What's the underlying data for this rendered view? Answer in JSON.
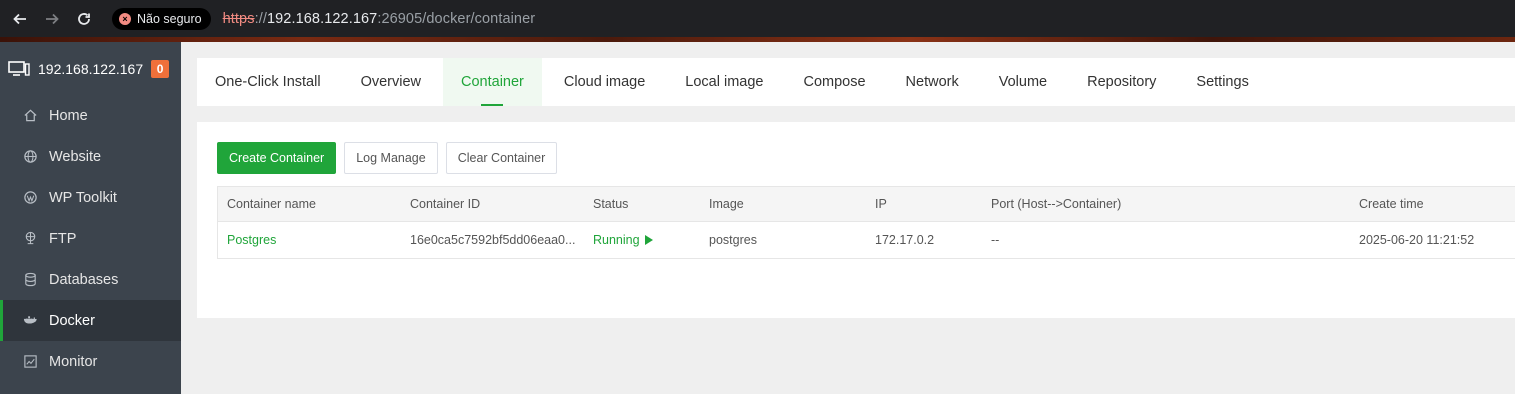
{
  "browser": {
    "security_label": "Não seguro",
    "url_scheme": "https",
    "url_sep": "://",
    "url_host": "192.168.122.167",
    "url_rest": ":26905/docker/container"
  },
  "sidebar": {
    "server_name": "192.168.122.167",
    "badge_count": "0",
    "items": [
      {
        "label": "Home",
        "icon": "home-icon"
      },
      {
        "label": "Website",
        "icon": "globe-icon"
      },
      {
        "label": "WP Toolkit",
        "icon": "wordpress-icon"
      },
      {
        "label": "FTP",
        "icon": "ftp-icon"
      },
      {
        "label": "Databases",
        "icon": "database-icon"
      },
      {
        "label": "Docker",
        "icon": "docker-icon",
        "active": true
      },
      {
        "label": "Monitor",
        "icon": "monitor-icon"
      }
    ]
  },
  "tabs": [
    {
      "label": "One-Click Install"
    },
    {
      "label": "Overview"
    },
    {
      "label": "Container",
      "active": true
    },
    {
      "label": "Cloud image"
    },
    {
      "label": "Local image"
    },
    {
      "label": "Compose"
    },
    {
      "label": "Network"
    },
    {
      "label": "Volume"
    },
    {
      "label": "Repository"
    },
    {
      "label": "Settings"
    }
  ],
  "toolbar": {
    "create_label": "Create Container",
    "log_label": "Log Manage",
    "clear_label": "Clear Container"
  },
  "table": {
    "headers": [
      "Container name",
      "Container ID",
      "Status",
      "Image",
      "IP",
      "Port (Host-->Container)",
      "Create time"
    ],
    "rows": [
      {
        "name": "Postgres",
        "id": "16e0ca5c7592bf5dd06eaa0...",
        "status": "Running",
        "image": "postgres",
        "ip": "172.17.0.2",
        "port": "--",
        "created": "2025-06-20 11:21:52"
      }
    ]
  },
  "colors": {
    "accent": "#20a53a",
    "sidebar_bg": "#3c444d",
    "badge": "#f0703a"
  }
}
